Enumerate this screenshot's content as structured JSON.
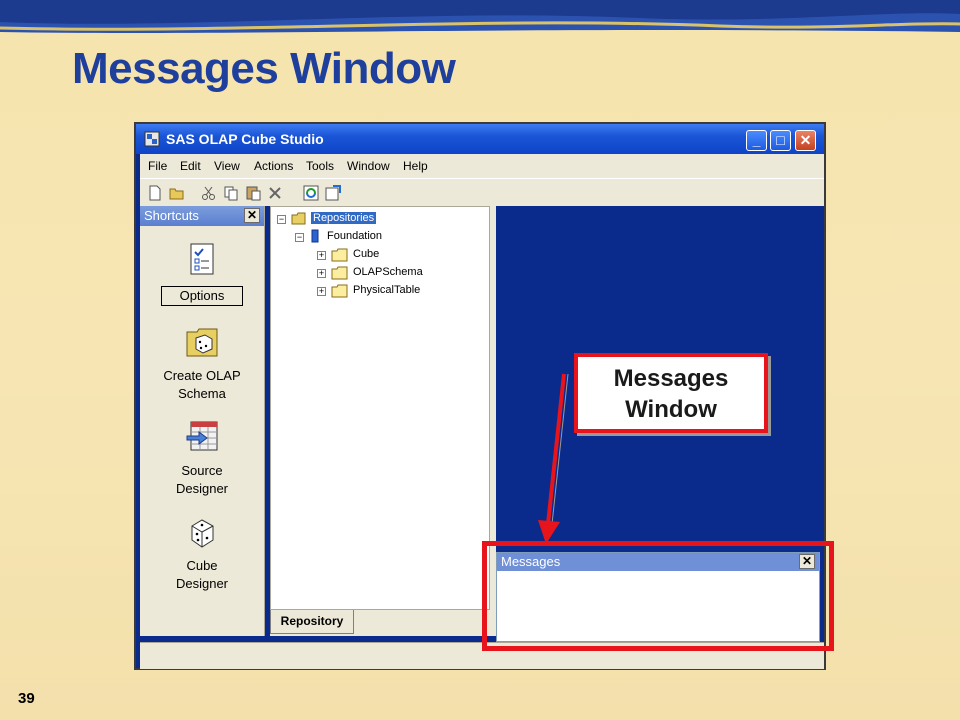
{
  "slide": {
    "title": "Messages Window",
    "page_number": "39"
  },
  "app": {
    "title": "SAS OLAP Cube Studio",
    "window_controls": [
      "minimize",
      "maximize",
      "close"
    ],
    "menu": [
      "File",
      "Edit",
      "View",
      "Actions",
      "Tools",
      "Window",
      "Help"
    ],
    "toolbar_icons": [
      "new-icon",
      "open-icon",
      "cut-icon",
      "copy-icon",
      "paste-icon",
      "delete-icon",
      "refresh-icon",
      "cube-action-icon"
    ]
  },
  "shortcuts": {
    "header": "Shortcuts",
    "items": [
      {
        "label": "Options",
        "icon": "options-icon"
      },
      {
        "label_line1": "Create OLAP",
        "label_line2": "Schema",
        "icon": "create-olap-schema-icon"
      },
      {
        "label_line1": "Source",
        "label_line2": "Designer",
        "icon": "source-designer-icon"
      },
      {
        "label_line1": "Cube",
        "label_line2": "Designer",
        "icon": "cube-designer-icon"
      }
    ]
  },
  "tree": {
    "root": "Repositories",
    "foundation": "Foundation",
    "children": [
      "Cube",
      "OLAPSchema",
      "PhysicalTable"
    ],
    "tab": "Repository"
  },
  "messages": {
    "header": "Messages"
  },
  "callout": {
    "line1": "Messages",
    "line2": "Window"
  },
  "colors": {
    "title_blue": "#1f3f9c",
    "callout_red": "#e8141c",
    "desktop_blue": "#0a2b8c"
  }
}
